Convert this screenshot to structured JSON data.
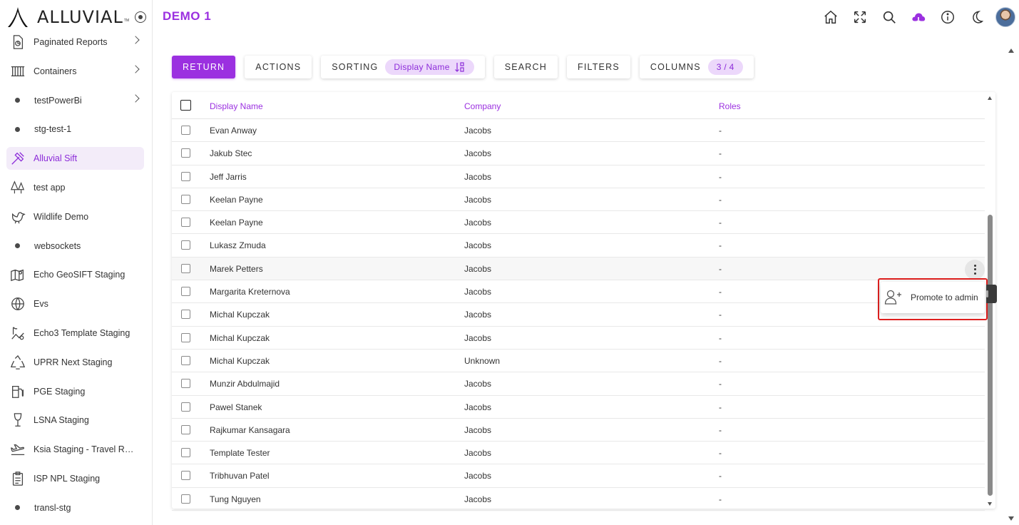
{
  "brand": {
    "name": "ALLUVIAL",
    "tm": "TM"
  },
  "page": {
    "title": "DEMO 1"
  },
  "sidebar": {
    "items": [
      {
        "label": "Paginated Reports",
        "icon": "report-icon",
        "chevron": true
      },
      {
        "label": "Containers",
        "icon": "containers-icon",
        "chevron": true
      },
      {
        "label": "testPowerBi",
        "icon": "dot",
        "chevron": true
      },
      {
        "label": "stg-test-1",
        "icon": "dot",
        "chevron": false
      },
      {
        "label": "Alluvial Sift",
        "icon": "sift-icon",
        "chevron": false,
        "active": true
      },
      {
        "label": "test app",
        "icon": "trees-icon",
        "chevron": false
      },
      {
        "label": "Wildlife Demo",
        "icon": "bird-icon",
        "chevron": false
      },
      {
        "label": "websockets",
        "icon": "dot",
        "chevron": false
      },
      {
        "label": "Echo GeoSIFT Staging",
        "icon": "map-icon",
        "chevron": false
      },
      {
        "label": "Evs",
        "icon": "globe-icon",
        "chevron": false
      },
      {
        "label": "Echo3 Template Staging",
        "icon": "geo-icon",
        "chevron": false
      },
      {
        "label": "UPRR Next Staging",
        "icon": "recycle-icon",
        "chevron": false
      },
      {
        "label": "PGE Staging",
        "icon": "fuel-icon",
        "chevron": false
      },
      {
        "label": "LSNA Staging",
        "icon": "glass-icon",
        "chevron": false
      },
      {
        "label": "Ksia Staging - Travel Requ...",
        "icon": "plane-icon",
        "chevron": false
      },
      {
        "label": "ISP NPL Staging",
        "icon": "clipboard-icon",
        "chevron": false
      },
      {
        "label": "transl-stg",
        "icon": "dot",
        "chevron": false
      }
    ]
  },
  "topbar": {
    "icons": [
      "home-icon",
      "fullscreen-icon",
      "search-icon",
      "cloud-icon",
      "info-icon",
      "moon-icon"
    ],
    "accent": "#9b30e0"
  },
  "toolbar": {
    "return_label": "RETURN",
    "actions_label": "ACTIONS",
    "sorting_label": "SORTING",
    "sorting_value": "Display Name",
    "search_label": "SEARCH",
    "filters_label": "FILTERS",
    "columns_label": "COLUMNS",
    "columns_value": "3 / 4"
  },
  "table": {
    "headers": {
      "name": "Display Name",
      "company": "Company",
      "roles": "Roles"
    },
    "rows": [
      {
        "name": "Evan Anway",
        "company": "Jacobs",
        "roles": "-"
      },
      {
        "name": "Jakub Stec",
        "company": "Jacobs",
        "roles": "-"
      },
      {
        "name": "Jeff Jarris",
        "company": "Jacobs",
        "roles": "-"
      },
      {
        "name": "Keelan Payne",
        "company": "Jacobs",
        "roles": "-"
      },
      {
        "name": "Keelan Payne",
        "company": "Jacobs",
        "roles": "-"
      },
      {
        "name": "Lukasz Zmuda",
        "company": "Jacobs",
        "roles": "-"
      },
      {
        "name": "Marek Petters",
        "company": "Jacobs",
        "roles": "-",
        "hover": true
      },
      {
        "name": "Margarita Kreternova",
        "company": "Jacobs",
        "roles": "-"
      },
      {
        "name": "Michal Kupczak",
        "company": "Jacobs",
        "roles": "-"
      },
      {
        "name": "Michal Kupczak",
        "company": "Jacobs",
        "roles": "-"
      },
      {
        "name": "Michal Kupczak",
        "company": "Unknown",
        "roles": "-"
      },
      {
        "name": "Munzir Abdulmajid",
        "company": "Jacobs",
        "roles": "-"
      },
      {
        "name": "Pawel Stanek",
        "company": "Jacobs",
        "roles": "-"
      },
      {
        "name": "Rajkumar Kansagara",
        "company": "Jacobs",
        "roles": "-"
      },
      {
        "name": "Template Tester",
        "company": "Jacobs",
        "roles": "-"
      },
      {
        "name": "Tribhuvan Patel",
        "company": "Jacobs",
        "roles": "-"
      },
      {
        "name": "Tung Nguyen",
        "company": "Jacobs",
        "roles": "-"
      }
    ]
  },
  "context_menu": {
    "item_label": "Promote to admin",
    "icon": "add-user-icon"
  }
}
